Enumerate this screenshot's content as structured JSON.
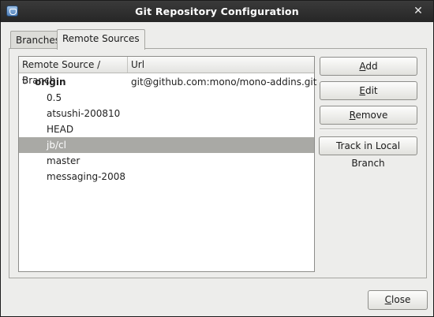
{
  "window": {
    "title": "Git Repository Configuration",
    "close_glyph": "✕",
    "app_icon": "monodevelop-icon"
  },
  "tabs": [
    {
      "label": "Branches",
      "active": false
    },
    {
      "label": "Remote Sources",
      "active": true
    }
  ],
  "tree": {
    "columns": [
      "Remote Source / Branch",
      "Url"
    ],
    "expander_glyph": "▽",
    "rows": [
      {
        "name": "origin",
        "url": "git@github.com:mono/mono-addins.git",
        "level": 0,
        "expanded": true,
        "selected": false
      },
      {
        "name": "0.5",
        "url": "",
        "level": 1,
        "selected": false
      },
      {
        "name": "atsushi-200810",
        "url": "",
        "level": 1,
        "selected": false
      },
      {
        "name": "HEAD",
        "url": "",
        "level": 1,
        "selected": false
      },
      {
        "name": "jb/cl",
        "url": "",
        "level": 1,
        "selected": true
      },
      {
        "name": "master",
        "url": "",
        "level": 1,
        "selected": false
      },
      {
        "name": "messaging-2008",
        "url": "",
        "level": 1,
        "selected": false
      }
    ]
  },
  "buttons": {
    "add": {
      "mnemonic": "A",
      "rest": "dd"
    },
    "edit": {
      "mnemonic": "E",
      "rest": "dit"
    },
    "remove": {
      "mnemonic": "R",
      "rest": "emove"
    },
    "track": "Track in Local Branch",
    "close": {
      "mnemonic": "C",
      "rest": "lose"
    }
  },
  "colors": {
    "selection": "#a9a9a5",
    "titlebar": "#2e2e2e"
  }
}
